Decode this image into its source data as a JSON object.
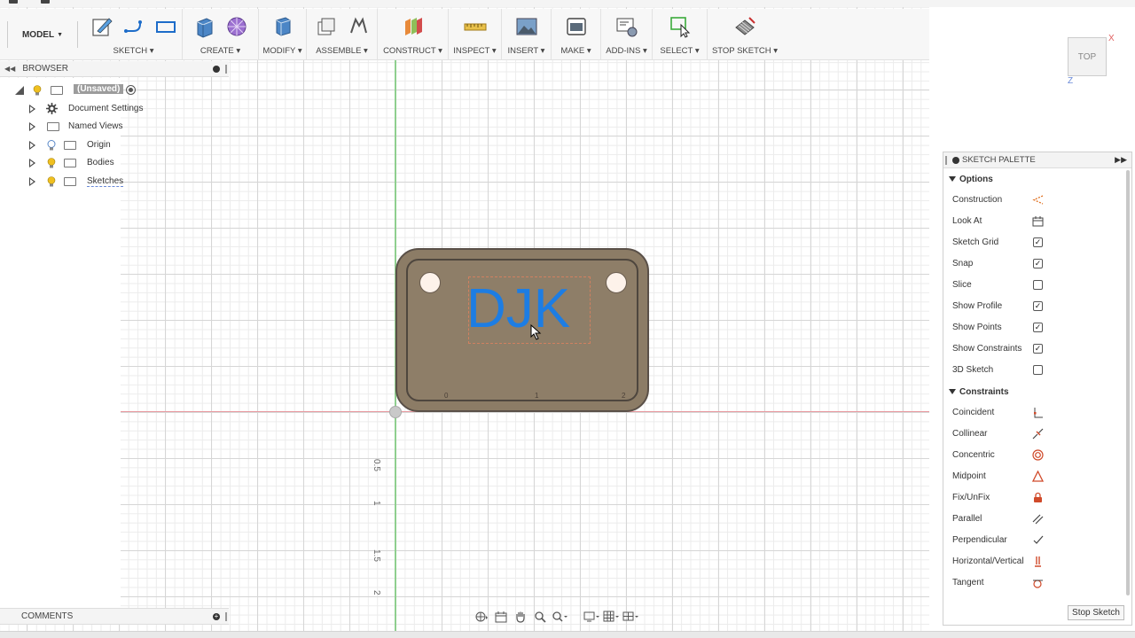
{
  "workspace": {
    "label": "MODEL"
  },
  "toolbar": {
    "groups": [
      {
        "key": "sketch",
        "label": "SKETCH ▾"
      },
      {
        "key": "create",
        "label": "CREATE ▾"
      },
      {
        "key": "modify",
        "label": "MODIFY ▾"
      },
      {
        "key": "assemble",
        "label": "ASSEMBLE ▾"
      },
      {
        "key": "construct",
        "label": "CONSTRUCT ▾"
      },
      {
        "key": "inspect",
        "label": "INSPECT ▾"
      },
      {
        "key": "insert",
        "label": "INSERT ▾"
      },
      {
        "key": "make",
        "label": "MAKE ▾"
      },
      {
        "key": "addins",
        "label": "ADD-INS ▾"
      },
      {
        "key": "select",
        "label": "SELECT ▾"
      },
      {
        "key": "stopsketch",
        "label": "STOP SKETCH ▾"
      }
    ]
  },
  "browser": {
    "title": "BROWSER",
    "root": "(Unsaved)",
    "items": [
      {
        "label": "Document Settings",
        "icon": "gear-icon"
      },
      {
        "label": "Named Views",
        "icon": "folder-icon"
      },
      {
        "label": "Origin",
        "icon": "folder-icon"
      },
      {
        "label": "Bodies",
        "icon": "folder-icon"
      },
      {
        "label": "Sketches",
        "icon": "folder-icon"
      }
    ]
  },
  "canvas": {
    "plate_text": "DJK",
    "plate_ticks": [
      "0",
      "1",
      "2"
    ],
    "ruler": [
      "0.5",
      "1",
      "1.5",
      "2"
    ]
  },
  "viewcube": {
    "face": "TOP",
    "x_axis": "X",
    "z_axis": "Z"
  },
  "palette": {
    "title": "SKETCH PALETTE",
    "options_title": "Options",
    "options": [
      {
        "label": "Construction",
        "control": "icon",
        "icon": "construction-icon"
      },
      {
        "label": "Look At",
        "control": "icon",
        "icon": "look-at-icon"
      },
      {
        "label": "Sketch Grid",
        "control": "checkbox",
        "checked": true
      },
      {
        "label": "Snap",
        "control": "checkbox",
        "checked": true
      },
      {
        "label": "Slice",
        "control": "checkbox",
        "checked": false
      },
      {
        "label": "Show Profile",
        "control": "checkbox",
        "checked": true
      },
      {
        "label": "Show Points",
        "control": "checkbox",
        "checked": true
      },
      {
        "label": "Show Constraints",
        "control": "checkbox",
        "checked": true
      },
      {
        "label": "3D Sketch",
        "control": "checkbox",
        "checked": false
      }
    ],
    "constraints_title": "Constraints",
    "constraints": [
      {
        "label": "Coincident",
        "icon": "coincident-icon"
      },
      {
        "label": "Collinear",
        "icon": "collinear-icon"
      },
      {
        "label": "Concentric",
        "icon": "concentric-icon"
      },
      {
        "label": "Midpoint",
        "icon": "midpoint-icon"
      },
      {
        "label": "Fix/UnFix",
        "icon": "fix-lock-icon"
      },
      {
        "label": "Parallel",
        "icon": "parallel-icon"
      },
      {
        "label": "Perpendicular",
        "icon": "perpendicular-icon"
      },
      {
        "label": "Horizontal/Vertical",
        "icon": "horizontal-vertical-icon"
      },
      {
        "label": "Tangent",
        "icon": "tangent-icon"
      }
    ],
    "stop_button": "Stop Sketch"
  },
  "comments": {
    "title": "COMMENTS"
  },
  "colors": {
    "accent": "#1d7de3",
    "plate": "#8c7c66",
    "constraint": "#d04a2a"
  }
}
